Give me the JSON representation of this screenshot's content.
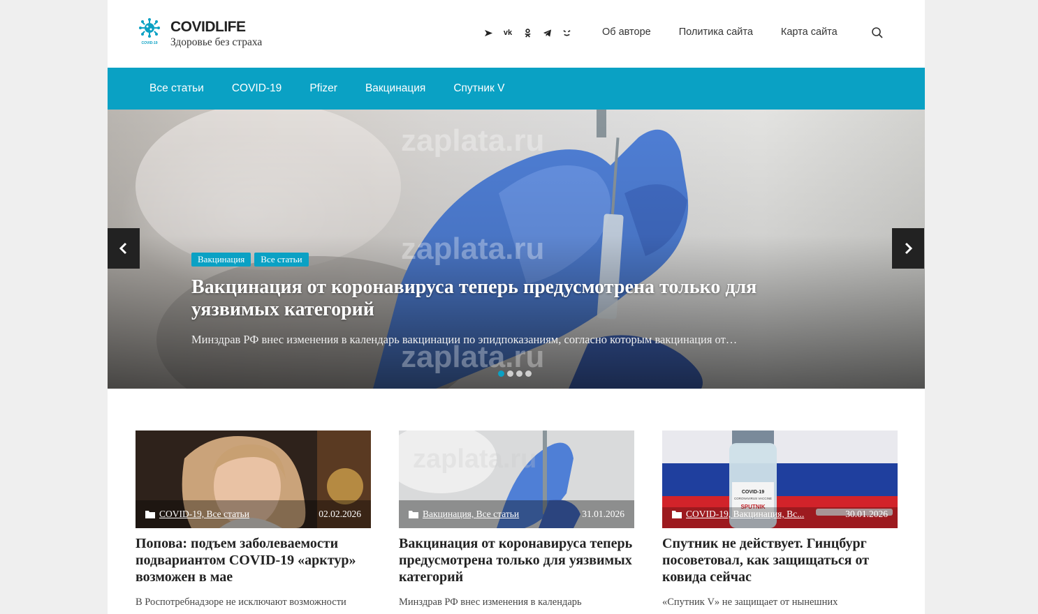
{
  "site": {
    "title": "COVIDLIFE",
    "tagline": "Здоровье без страха",
    "logo_badge": "COVID-19"
  },
  "social": [
    {
      "name": "share-icon"
    },
    {
      "name": "vk-icon",
      "label": "vk"
    },
    {
      "name": "odnoklassniki-icon"
    },
    {
      "name": "telegram-icon"
    },
    {
      "name": "dzen-icon"
    }
  ],
  "top_links": [
    "Об авторе",
    "Политика сайта",
    "Карта сайта"
  ],
  "nav": [
    "Все статьи",
    "COVID-19",
    "Pfizer",
    "Вакцинация",
    "Спутник V"
  ],
  "hero": {
    "tags": [
      "Вакцинация",
      "Все статьи"
    ],
    "title": "Вакцинация от коронавируса теперь предусмотрена только для уязвимых категорий",
    "excerpt": "Минздрав РФ внес изменения в календарь вакцинации по эпидпоказаниям, согласно которым вакцинация от…",
    "slides": 4,
    "active_slide": 0
  },
  "watermark": "zaplata.ru",
  "cards": [
    {
      "categories": "COVID-19, Все статьи",
      "date": "02.02.2026",
      "title": "Попова: подъем заболеваемости подвариантом COVID-19 «арктур» возможен в мае",
      "excerpt": "В Роспотребнадзоре не исключают возможности"
    },
    {
      "categories": "Вакцинация, Все статьи",
      "date": "31.01.2026",
      "title": "Вакцинация от коронавируса теперь предусмотрена только для уязвимых категорий",
      "excerpt": "Минздрав РФ внес изменения в календарь"
    },
    {
      "categories": "COVID-19, Вакцинация, Вс...",
      "date": "30.01.2026",
      "title": "Спутник не действует. Гинцбург посоветовал, как защищаться от ковида сейчас",
      "excerpt": "«Спутник V» не защищает от нынешних",
      "vial_label": "COVID-19",
      "vial_sub": "CORONAVIRUS VACCINE",
      "vial_brand": "SPUTNIK"
    }
  ],
  "colors": {
    "accent": "#0aa1c4",
    "page_bg": "#efefef",
    "arrow_bg": "#222222"
  }
}
